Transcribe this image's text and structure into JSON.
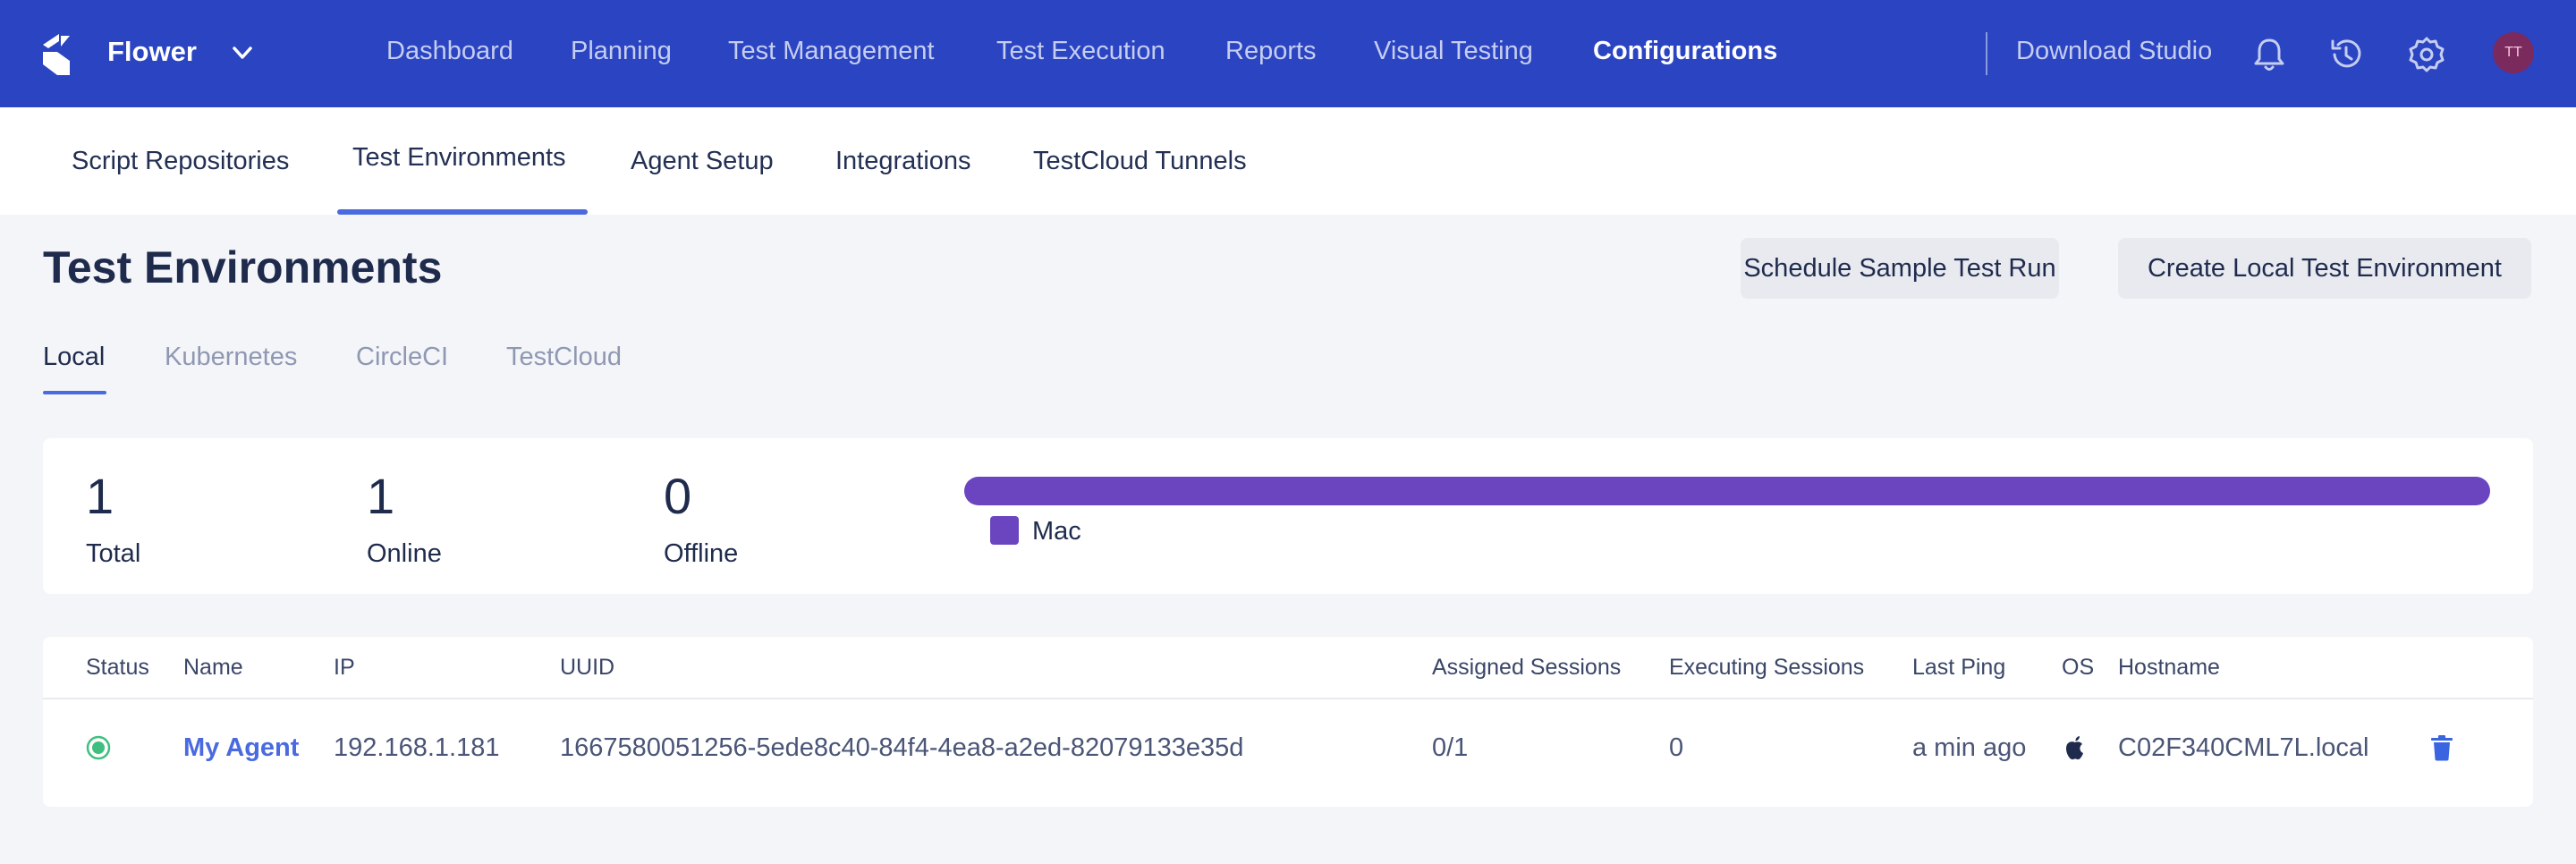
{
  "topnav": {
    "org_name": "Flower",
    "items": [
      "Dashboard",
      "Planning",
      "Test Management",
      "Test Execution",
      "Reports",
      "Visual Testing",
      "Configurations"
    ],
    "active": "Configurations",
    "download": "Download Studio",
    "avatar_initials": "TT"
  },
  "subnav": {
    "tabs": [
      "Script Repositories",
      "Test Environments",
      "Agent Setup",
      "Integrations",
      "TestCloud Tunnels"
    ],
    "active": "Test Environments"
  },
  "page": {
    "title": "Test Environments",
    "schedule_button": "Schedule Sample Test Run",
    "create_button": "Create Local Test Environment"
  },
  "env_tabs": {
    "tabs": [
      "Local",
      "Kubernetes",
      "CircleCI",
      "TestCloud"
    ],
    "active": "Local"
  },
  "stats": {
    "total_value": "1",
    "total_label": "Total",
    "online_value": "1",
    "online_label": "Online",
    "offline_value": "0",
    "offline_label": "Offline",
    "legend_label": "Mac",
    "mac_share": 1.0,
    "bar_color": "#6b45c0"
  },
  "table": {
    "headers": [
      "Status",
      "Name",
      "IP",
      "UUID",
      "Assigned Sessions",
      "Executing Sessions",
      "Last Ping",
      "OS",
      "Hostname"
    ],
    "rows": [
      {
        "status": "online",
        "name": "My Agent",
        "ip": "192.168.1.181",
        "uuid": "1667580051256-5ede8c40-84f4-4ea8-a2ed-82079133e35d",
        "assigned_sessions": "0/1",
        "executing_sessions": "0",
        "last_ping": "a min ago",
        "os": "apple-icon",
        "hostname": "C02F340CML7L.local"
      }
    ]
  },
  "colors": {
    "topbar": "#2a44c2",
    "accent": "#4a6ae0",
    "online": "#3fbf7f",
    "delete": "#3a64e0"
  }
}
